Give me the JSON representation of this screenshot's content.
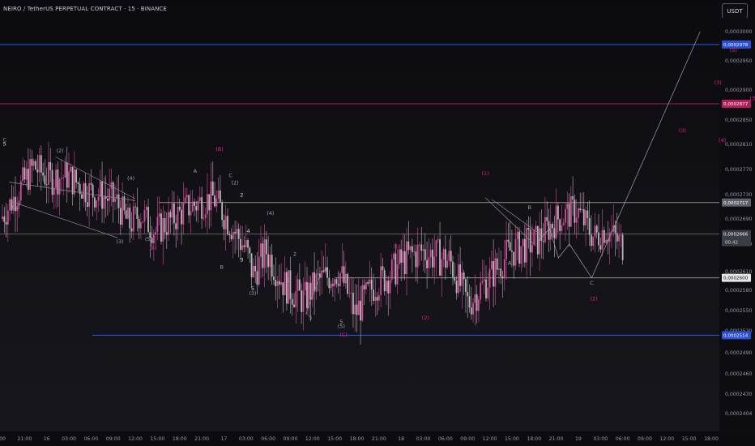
{
  "header": {
    "title": "NEIRO / TetherUS PERPETUAL CONTRACT · 15 · BINANCE",
    "currency_button": "USDT"
  },
  "colors": {
    "up": "#d24d9a",
    "down": "#b8b8b8",
    "blue_line": "#2962ff",
    "magenta_line": "#c2185b",
    "gray_line": "#9e9e9e",
    "pink_label": "#e91e8c",
    "gray_label": "#9aa0a6"
  },
  "chart_data": {
    "type": "candlestick",
    "symbol": "NEIRO / TetherUS PERPETUAL CONTRACT · 15 · BINANCE",
    "x_tick_labels": [
      "00",
      "21:00",
      "16",
      "03:00",
      "06:00",
      "09:00",
      "12:00",
      "15:00",
      "18:00",
      "21:00",
      "17",
      "03:00",
      "06:00",
      "09:00",
      "12:00",
      "15:00",
      "18:00",
      "21:00",
      "18",
      "03:00",
      "06:00",
      "09:00",
      "12:00",
      "15:00",
      "18:00",
      "21:00",
      "19",
      "03:00",
      "06:00",
      "09:00",
      "12:00",
      "15:00",
      "18:00"
    ],
    "y_tick_labels": [
      "0,0003000",
      "0,0002950",
      "0,0002900",
      "0,0002850",
      "0,0002810",
      "0,0002770",
      "0,0002730",
      "0,0002690",
      "0,0002650",
      "0,0002610",
      "0,0002580",
      "0,0002550",
      "0,0002520",
      "0,0002490",
      "0,0002460",
      "0,0002430",
      "0,0002404"
    ],
    "y_range": [
      0.00024,
      0.000301
    ],
    "horizontal_levels": [
      {
        "label": "0,0002978",
        "value": 0.0002978,
        "color": "#2962ff"
      },
      {
        "label": "0,0002877",
        "value": 0.0002877,
        "color": "#c2185b"
      },
      {
        "label": "0,0002717",
        "value": 0.0002717,
        "color": "#9e9e9e"
      },
      {
        "label": "0,0002666",
        "value": 0.0002666,
        "color": "#9e9e9e",
        "sublabel": "00:42",
        "current_price": true
      },
      {
        "label": "0,0002600",
        "value": 0.00026,
        "color": "#9e9e9e"
      },
      {
        "label": "0,0002514",
        "value": 0.0002514,
        "color": "#2962ff"
      }
    ],
    "price_path_points": [
      [
        0.0,
        0.000269
      ],
      [
        1.5,
        0.0002775
      ],
      [
        2.2,
        0.0002755
      ],
      [
        3.0,
        0.000276
      ],
      [
        4.0,
        0.0002735
      ],
      [
        5.2,
        0.000272
      ],
      [
        5.8,
        0.000268
      ],
      [
        6.3,
        0.00027
      ],
      [
        7.0,
        0.000267
      ],
      [
        8.5,
        0.000271
      ],
      [
        9.6,
        0.0002725
      ],
      [
        10.4,
        0.000268
      ],
      [
        11.1,
        0.000264
      ],
      [
        11.4,
        0.0002605
      ],
      [
        12.0,
        0.000264
      ],
      [
        12.8,
        0.000259
      ],
      [
        13.7,
        0.0002565
      ],
      [
        14.3,
        0.0002595
      ],
      [
        15.3,
        0.000261
      ],
      [
        16.0,
        0.0002545
      ],
      [
        16.9,
        0.000259
      ],
      [
        17.6,
        0.0002605
      ],
      [
        18.3,
        0.000263
      ],
      [
        19.0,
        0.000264
      ],
      [
        20.3,
        0.0002625
      ],
      [
        21.1,
        0.000256
      ],
      [
        22.3,
        0.000261
      ],
      [
        23.0,
        0.000264
      ],
      [
        24.2,
        0.0002655
      ],
      [
        25.1,
        0.000269
      ],
      [
        26.0,
        0.0002705
      ],
      [
        26.8,
        0.000266
      ],
      [
        27.3,
        0.0002675
      ],
      [
        28.0,
        0.000265
      ]
    ],
    "wave_labels": [
      {
        "text": "C",
        "t": 0.1,
        "v": 0.0002815,
        "color": "gray"
      },
      {
        "text": "5",
        "t": 0.1,
        "v": 0.0002808,
        "color": "white"
      },
      {
        "text": "4",
        "t": -0.2,
        "v": 0.0002703,
        "color": "white"
      },
      {
        "text": "(1)",
        "t": 0.6,
        "v": 0.0002707,
        "color": "gray"
      },
      {
        "text": "(2)",
        "t": 2.6,
        "v": 0.0002797,
        "color": "gray"
      },
      {
        "text": "(3)",
        "t": 5.3,
        "v": 0.0002651,
        "color": "gray"
      },
      {
        "text": "(4)",
        "t": 5.8,
        "v": 0.0002753,
        "color": "gray"
      },
      {
        "text": "(5)",
        "t": 6.6,
        "v": 0.0002655,
        "color": "gray"
      },
      {
        "text": "(4)",
        "t": 6.8,
        "v": 0.0002642,
        "color": "pink"
      },
      {
        "text": "(B)",
        "t": 9.8,
        "v": 0.00028,
        "color": "pink"
      },
      {
        "text": "A",
        "t": 8.7,
        "v": 0.0002765,
        "color": "gray"
      },
      {
        "text": "C",
        "t": 10.3,
        "v": 0.0002758,
        "color": "gray"
      },
      {
        "text": "(2)",
        "t": 10.5,
        "v": 0.0002746,
        "color": "gray"
      },
      {
        "text": "2",
        "t": 10.8,
        "v": 0.0002727,
        "color": "white"
      },
      {
        "text": "(4)",
        "t": 12.1,
        "v": 0.0002697,
        "color": "gray"
      },
      {
        "text": "4",
        "t": 11.1,
        "v": 0.0002668,
        "color": "white"
      },
      {
        "text": "3",
        "t": 10.8,
        "v": 0.0002625,
        "color": "white"
      },
      {
        "text": "B",
        "t": 9.9,
        "v": 0.0002614,
        "color": "gray"
      },
      {
        "text": "2",
        "t": 13.2,
        "v": 0.0002633,
        "color": "gray"
      },
      {
        "text": "4",
        "t": 14.6,
        "v": 0.0002611,
        "color": "gray"
      },
      {
        "text": "1",
        "t": 12.9,
        "v": 0.0002593,
        "color": "gray"
      },
      {
        "text": "5",
        "t": 11.3,
        "v": 0.000258,
        "color": "white"
      },
      {
        "text": "(3)",
        "t": 11.3,
        "v": 0.0002573,
        "color": "gray"
      },
      {
        "text": "3",
        "t": 13.9,
        "v": 0.0002537,
        "color": "gray"
      },
      {
        "text": "5",
        "t": 15.3,
        "v": 0.0002531,
        "color": "gray"
      },
      {
        "text": "(5)",
        "t": 15.3,
        "v": 0.0002524,
        "color": "gray"
      },
      {
        "text": "(C)",
        "t": 15.4,
        "v": 0.0002512,
        "color": "pink"
      },
      {
        "text": "(1)",
        "t": 17.8,
        "v": 0.0002644,
        "color": "pink"
      },
      {
        "text": "(2)",
        "t": 19.1,
        "v": 0.0002537,
        "color": "pink"
      },
      {
        "text": "(1)",
        "t": 21.8,
        "v": 0.0002761,
        "color": "pink"
      },
      {
        "text": "B",
        "t": 23.8,
        "v": 0.0002706,
        "color": "gray"
      },
      {
        "text": "A",
        "t": 22.9,
        "v": 0.000262,
        "color": "gray"
      },
      {
        "text": "C",
        "t": 26.6,
        "v": 0.0002589,
        "color": "gray"
      },
      {
        "text": "(2)",
        "t": 26.7,
        "v": 0.0002565,
        "color": "pink"
      },
      {
        "text": "(3)",
        "t": 30.7,
        "v": 0.000283,
        "color": "pink"
      },
      {
        "text": "(4)",
        "t": 32.5,
        "v": 0.0002814,
        "color": "pink"
      },
      {
        "text": "(3)",
        "t": 32.3,
        "v": 0.000291,
        "color": "pink"
      },
      {
        "text": "(3)",
        "t": 33.9,
        "v": 0.0002883,
        "color": "pink"
      },
      {
        "text": "(4)",
        "t": 34.9,
        "v": 0.000292,
        "color": "pink"
      },
      {
        "text": "(5)",
        "t": 33.0,
        "v": 0.0002965,
        "color": "pink"
      }
    ],
    "projection_path": [
      [
        24.2,
        0.0002655
      ],
      [
        24.7,
        0.0002675
      ],
      [
        25.1,
        0.000263
      ],
      [
        25.6,
        0.000265
      ],
      [
        26.6,
        0.00026
      ],
      [
        31.5,
        0.0003
      ]
    ],
    "channel_lines": [
      {
        "from": [
          0.3,
          0.000275
        ],
        "to": [
          6.0,
          0.000272
        ]
      },
      {
        "from": [
          0.3,
          0.000272
        ],
        "to": [
          5.2,
          0.000266
        ]
      },
      {
        "from": [
          2.4,
          0.000279
        ],
        "to": [
          6.0,
          0.0002723
        ]
      },
      {
        "from": [
          13.7,
          0.0002545
        ],
        "to": [
          14.3,
          0.00026
        ]
      },
      {
        "from": [
          21.8,
          0.0002725
        ],
        "to": [
          24.0,
          0.000265
        ]
      },
      {
        "from": [
          22.1,
          0.0002722
        ],
        "to": [
          24.3,
          0.0002665
        ]
      }
    ]
  }
}
